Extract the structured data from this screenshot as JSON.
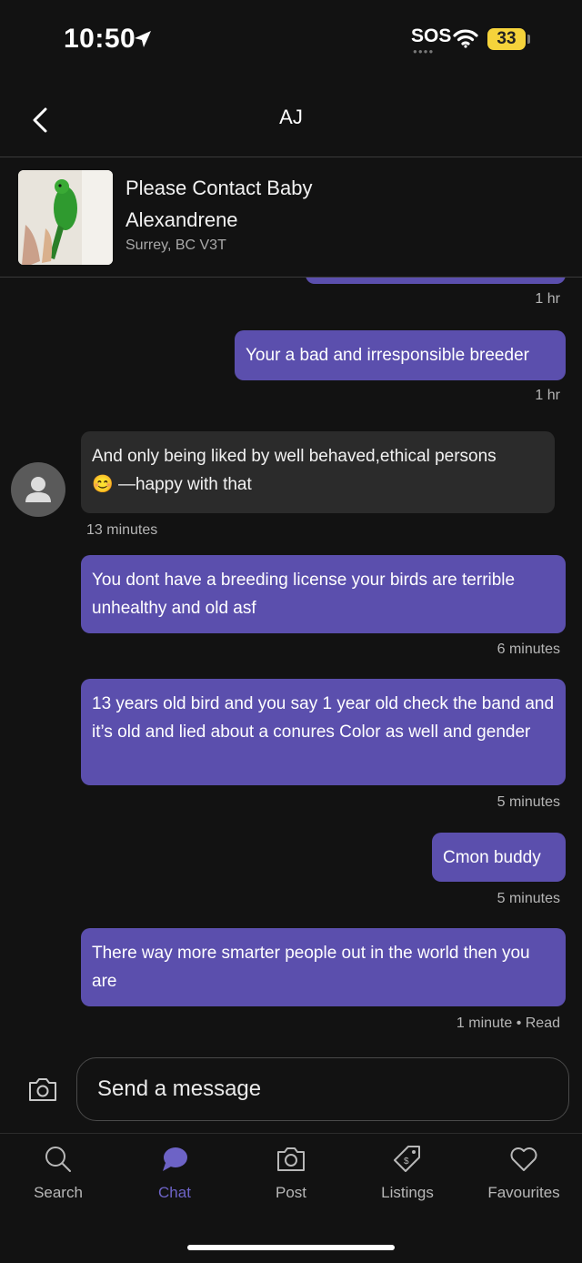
{
  "status_bar": {
    "time": "10:50",
    "sos": "SOS",
    "battery": "33"
  },
  "header": {
    "title": "AJ",
    "back_icon": "chevron-left-icon"
  },
  "listing": {
    "title": "Please Contact Baby Alexandrene",
    "location": "Surrey, BC V3T"
  },
  "messages": [
    {
      "id": "m1",
      "direction": "out",
      "text": "Your a bad and irresponsible breeder",
      "time": "1 hr"
    },
    {
      "id": "m2",
      "direction": "in",
      "text": "And only being liked by well behaved,ethical persons",
      "emoji": "😊",
      "text2": "—happy with that",
      "time": "13 minutes"
    },
    {
      "id": "m3",
      "direction": "out",
      "text": "You dont have a breeding license your birds are terrible unhealthy and old asf",
      "time": "6 minutes"
    },
    {
      "id": "m4",
      "direction": "out",
      "text": "13 years old bird and you say 1 year old check the band and it’s old and lied about a conures Color as well and gender",
      "time": "5 minutes"
    },
    {
      "id": "m5",
      "direction": "out",
      "text": "Cmon buddy",
      "time": "5 minutes"
    },
    {
      "id": "m6",
      "direction": "out",
      "text": "There way more smarter people out in the world then you are",
      "time": "1 minute • Read"
    }
  ],
  "earlier_time": "1 hr",
  "composer": {
    "placeholder": "Send a message"
  },
  "tabs": [
    {
      "label": "Search",
      "icon": "search-icon"
    },
    {
      "label": "Chat",
      "icon": "chat-icon",
      "active": true
    },
    {
      "label": "Post",
      "icon": "camera-icon"
    },
    {
      "label": "Listings",
      "icon": "tag-icon"
    },
    {
      "label": "Favourites",
      "icon": "heart-icon"
    }
  ],
  "colors": {
    "background": "#121212",
    "outgoing_bubble": "#5b4fad",
    "incoming_bubble": "#2b2b2b",
    "accent": "#6d63c6"
  }
}
